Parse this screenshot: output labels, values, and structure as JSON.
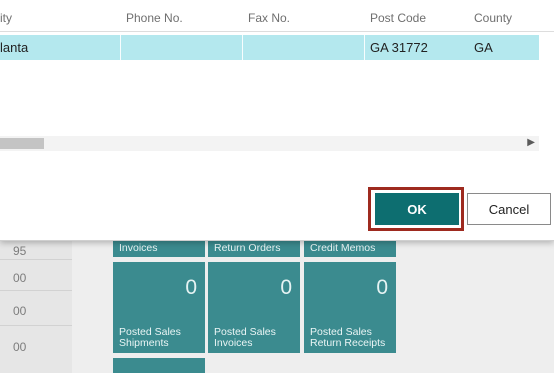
{
  "dialog": {
    "columns": [
      "ity",
      "Phone No.",
      "Fax No.",
      "Post Code",
      "County"
    ],
    "row": {
      "city": "lanta",
      "phone": "",
      "fax": "",
      "post_code": "GA 31772",
      "county": "GA"
    },
    "scroll_right_icon": "triangle-right-icon",
    "ok_label": "OK",
    "cancel_label": "Cancel"
  },
  "background": {
    "left_values": [
      "95",
      "00",
      "00",
      "00"
    ],
    "tiles_top": [
      "Invoices",
      "Return Orders",
      "Credit Memos"
    ],
    "tiles": [
      {
        "count": "0",
        "label_line1": "Posted Sales",
        "label_line2": "Shipments"
      },
      {
        "count": "0",
        "label_line1": "Posted Sales",
        "label_line2": "Invoices"
      },
      {
        "count": "0",
        "label_line1": "Posted Sales",
        "label_line2": "Return Receipts"
      }
    ]
  },
  "colors": {
    "selected_row": "#b4e8ee",
    "tile": "#3b8b8f",
    "ok_button": "#0d6e70",
    "focus_outline": "#9e2a1f"
  }
}
